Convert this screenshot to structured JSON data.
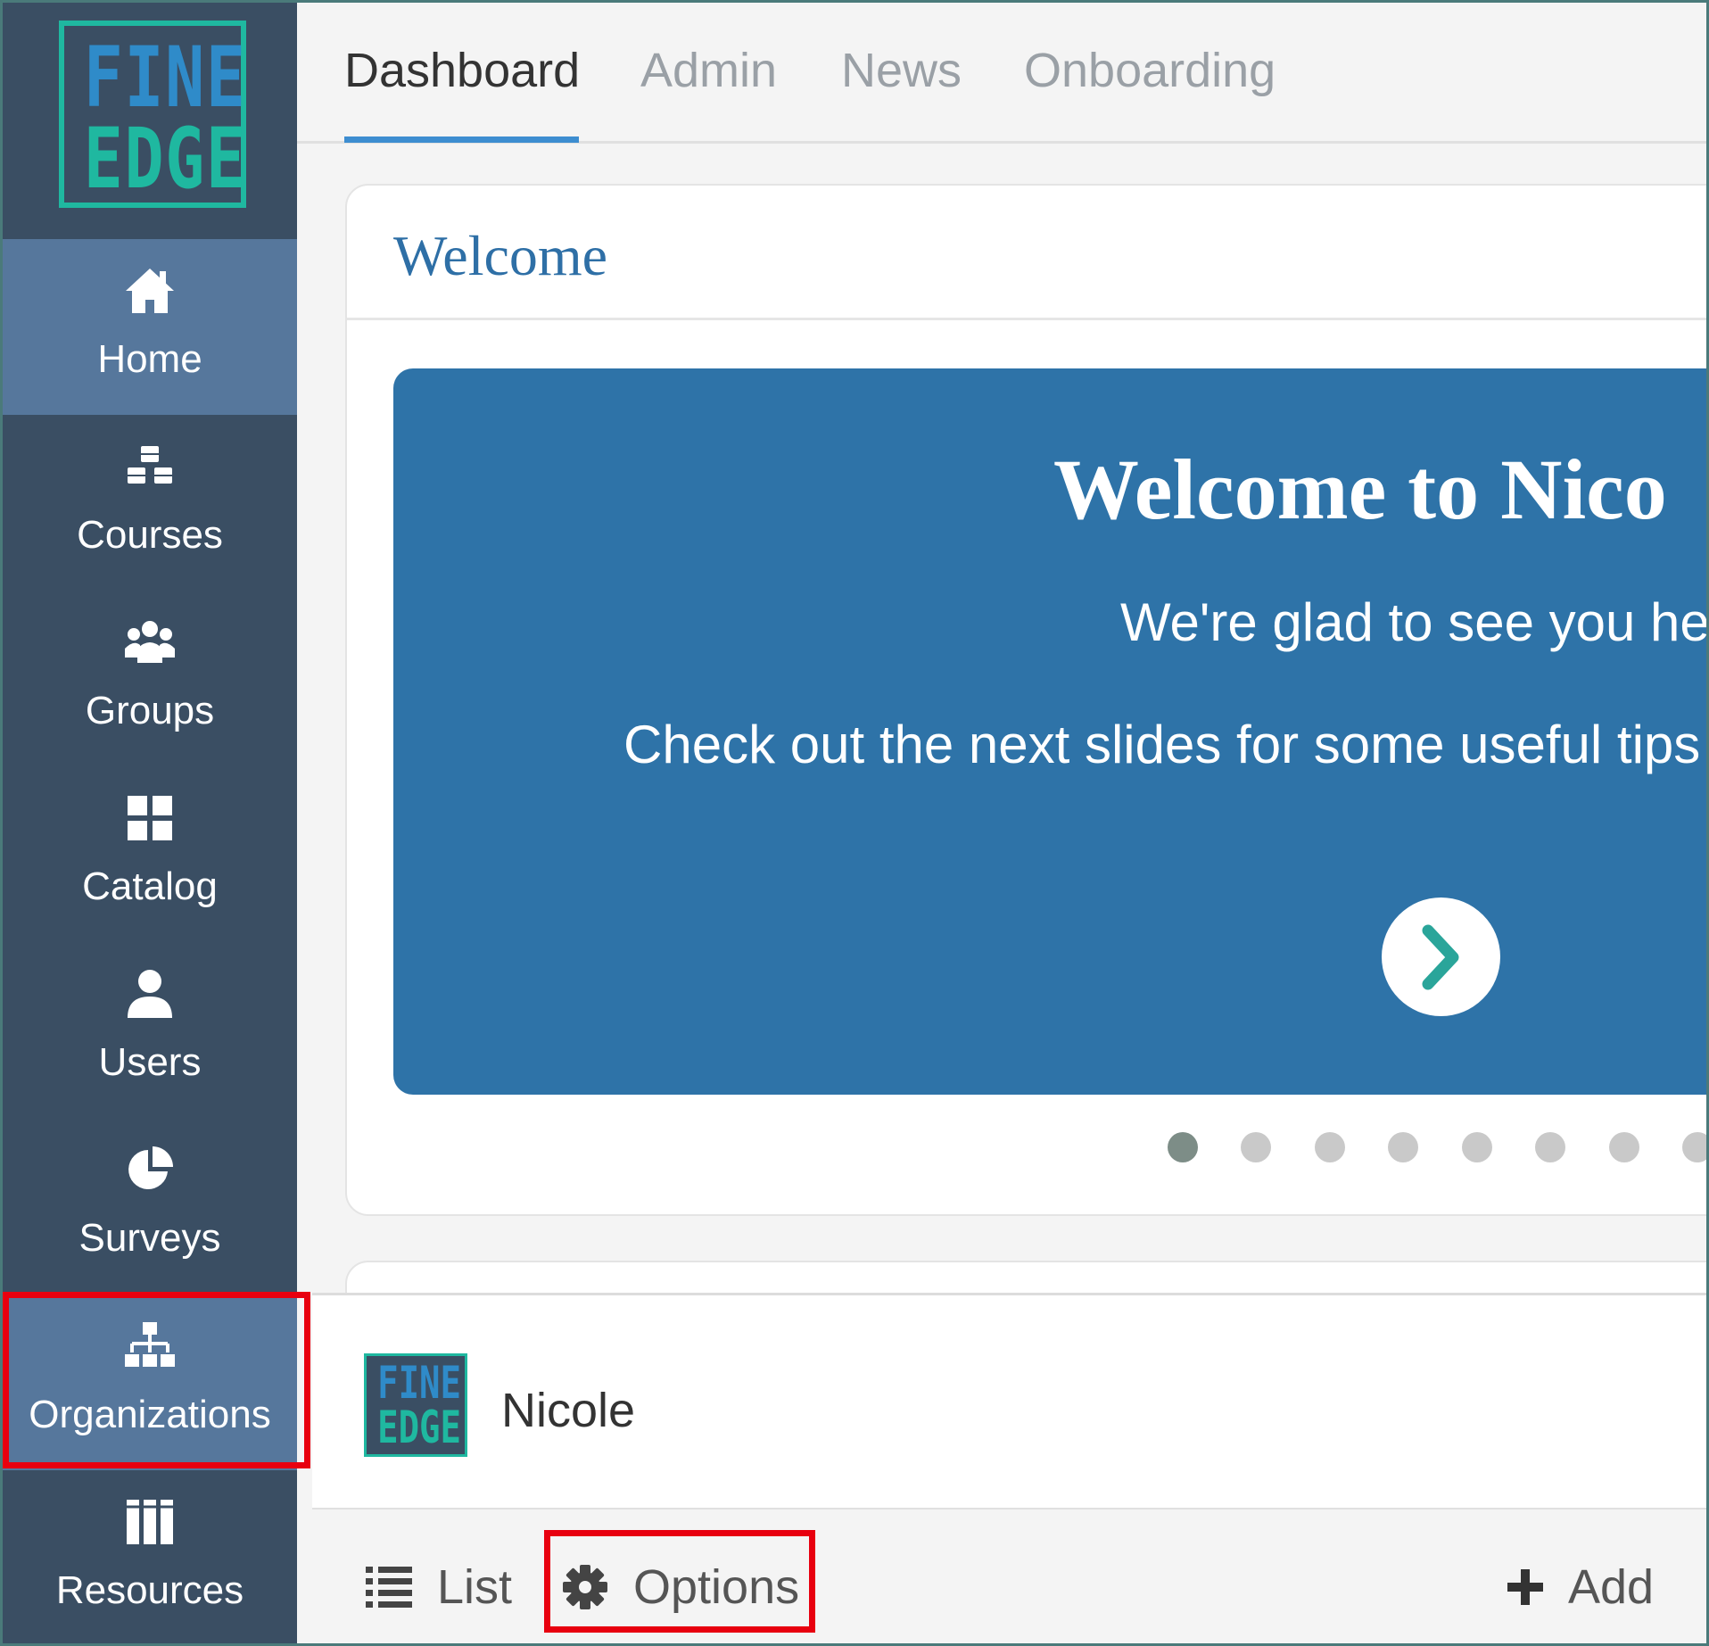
{
  "logo": {
    "line1": "FINE",
    "line2": "EDGE"
  },
  "sidebar": {
    "items": [
      {
        "label": "Home",
        "icon": "home-icon",
        "active": true
      },
      {
        "label": "Courses",
        "icon": "cubes-icon",
        "active": false
      },
      {
        "label": "Groups",
        "icon": "users-group-icon",
        "active": false
      },
      {
        "label": "Catalog",
        "icon": "grid-icon",
        "active": false
      },
      {
        "label": "Users",
        "icon": "user-icon",
        "active": false
      },
      {
        "label": "Surveys",
        "icon": "pie-chart-icon",
        "active": false
      },
      {
        "label": "Organizations",
        "icon": "sitemap-icon",
        "active": true
      },
      {
        "label": "Resources",
        "icon": "books-icon",
        "active": false
      }
    ]
  },
  "tabs": [
    {
      "label": "Dashboard",
      "active": true
    },
    {
      "label": "Admin",
      "active": false
    },
    {
      "label": "News",
      "active": false
    },
    {
      "label": "Onboarding",
      "active": false
    }
  ],
  "welcome_card": {
    "title": "Welcome",
    "slide": {
      "heading": "Welcome to Nico",
      "subtitle": "We're glad to see you her",
      "tips": "Check out the next slides for some useful tips"
    },
    "dots_active_index": 0
  },
  "org_panel": {
    "logo_line1": "FINE",
    "logo_line2": "EDGE",
    "name": "Nicole",
    "toolbar": {
      "list_label": "List",
      "options_label": "Options",
      "add_label": "Add"
    }
  },
  "colors": {
    "sidebar_bg": "#3a4e63",
    "sidebar_active": "#56779c",
    "accent_blue": "#3d8dd0",
    "slide_bg": "#2e73a8",
    "brand_teal": "#1fb8a0",
    "highlight_red": "#e8000f"
  }
}
